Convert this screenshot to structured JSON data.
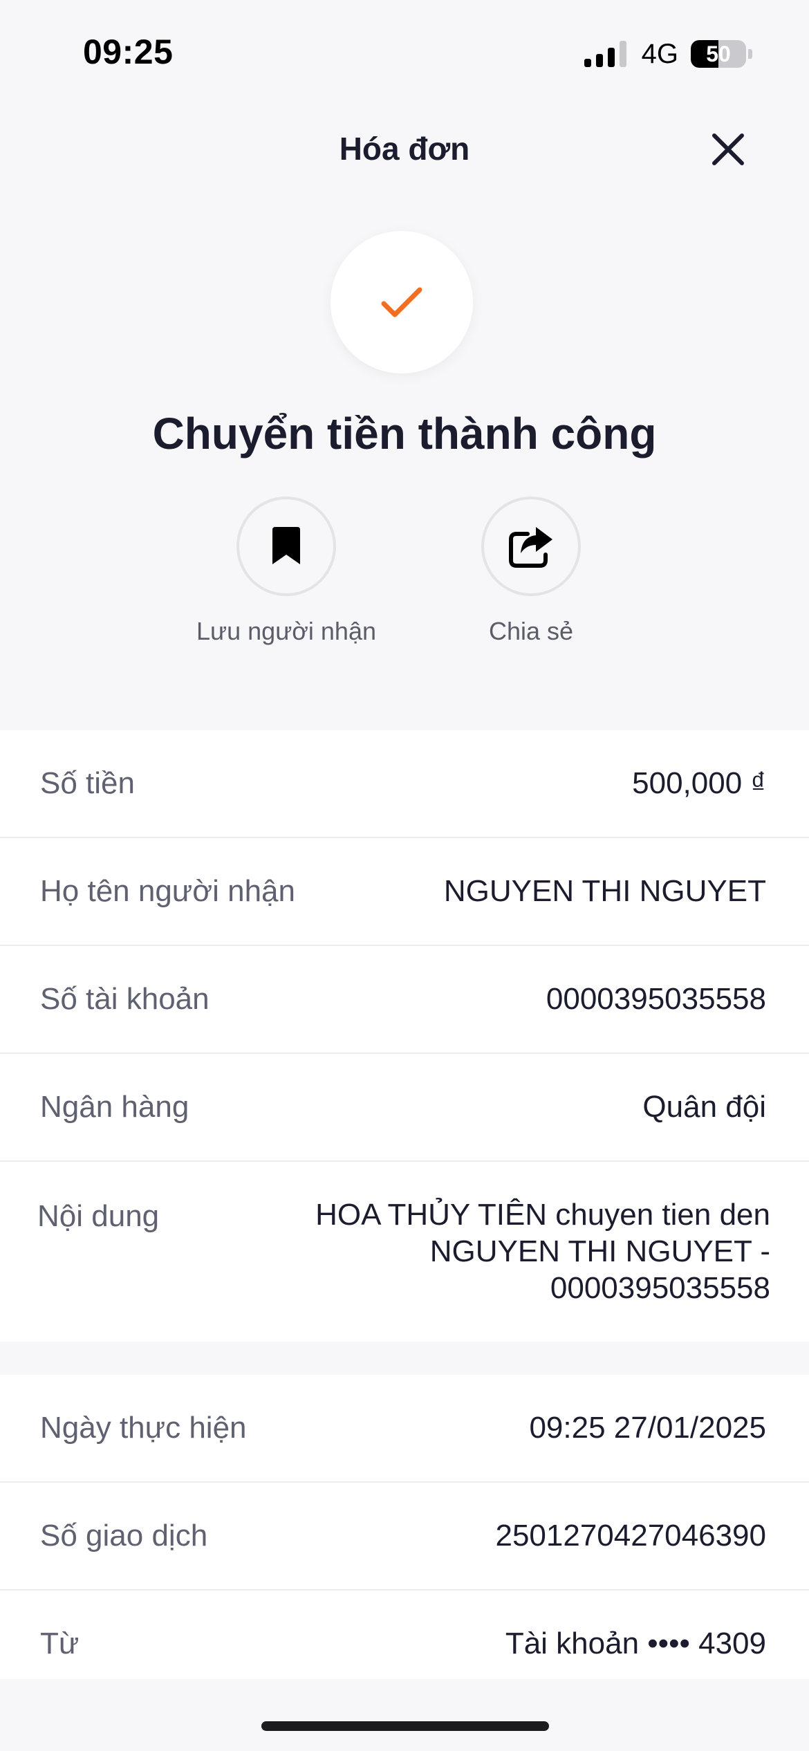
{
  "status_bar": {
    "time": "09:25",
    "network": "4G",
    "battery": "50",
    "battery_level": 0.5
  },
  "header": {
    "title": "Hóa đơn",
    "close_icon": "close-icon"
  },
  "success": {
    "icon": "checkmark-icon",
    "accent_color": "#f26f21",
    "title": "Chuyển tiền thành công"
  },
  "actions": [
    {
      "icon": "bookmark-icon",
      "label": "Lưu người nhận"
    },
    {
      "icon": "share-icon",
      "label": "Chia sẻ"
    }
  ],
  "transfer_details": {
    "amount": {
      "label": "Số tiền",
      "value": "500,000 ₫"
    },
    "recipient_name": {
      "label": "Họ tên người nhận",
      "value": "NGUYEN THI NGUYET"
    },
    "account_number": {
      "label": "Số tài khoản",
      "value": "0000395035558"
    },
    "bank": {
      "label": "Ngân hàng",
      "value": "Quân đội"
    },
    "content": {
      "label": "Nội dung",
      "value": "HOA THỦY TIÊN chuyen tien den\nNGUYEN THI NGUYET -\n0000395035558"
    }
  },
  "transaction_info": {
    "date": {
      "label": "Ngày thực hiện",
      "value": "09:25 27/01/2025"
    },
    "transaction_id": {
      "label": "Số giao dịch",
      "value": "2501270427046390"
    },
    "from": {
      "label": "Từ",
      "value": "Tài khoản •••• 4309"
    }
  }
}
